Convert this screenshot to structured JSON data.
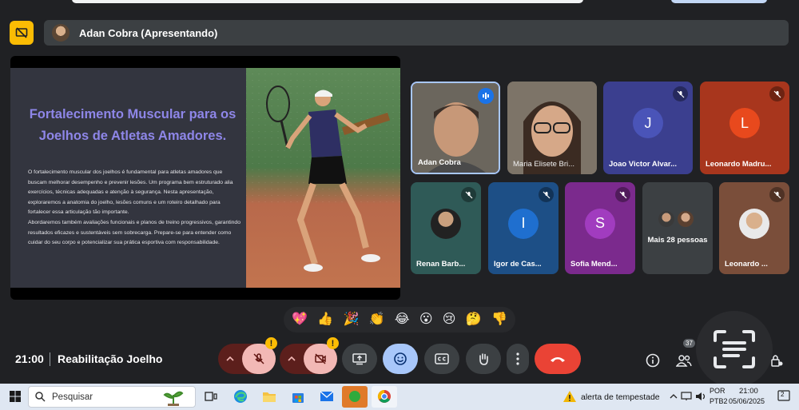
{
  "presenter_bar": {
    "name": "Adan Cobra (Apresentando)"
  },
  "slide": {
    "title": "Fortalecimento Muscular para os Joelhos de Atletas Amadores.",
    "paragraph1": "O fortalecimento muscular dos joelhos é fundamental para atletas amadores que buscam melhorar desempenho e prevenir lesões. Um programa bem estruturado alia exercícios, técnicas adequadas e atenção à segurança. Nesta apresentação, exploraremos a anatomia do joelho, lesões comuns e um roteiro detalhado para fortalecer essa articulação tão importante.",
    "paragraph2": "Abordaremos também avaliações funcionais e planos de treino progressivos, garantindo resultados eficazes e sustentáveis sem sobrecarga. Prepare-se para entender como cuidar do seu corpo e potencializar sua prática esportiva com responsabilidade."
  },
  "participants": [
    {
      "name": "Adan Cobra",
      "type": "video",
      "speaking": true
    },
    {
      "name": "Maria Elisete Bri...",
      "type": "video"
    },
    {
      "name": "Joao Victor Alvar...",
      "letter": "J",
      "bg": "#3b3f8f",
      "avatar_bg": "#4a54b8",
      "muted": true
    },
    {
      "name": "Leonardo Madru...",
      "letter": "L",
      "bg": "#a8361d",
      "avatar_bg": "#e8491d",
      "muted": true
    },
    {
      "name": "Renan Barb...",
      "type": "photo",
      "bg": "#2f5a57",
      "muted": true
    },
    {
      "name": "Igor de Cas...",
      "letter": "I",
      "bg": "#1d4f86",
      "avatar_bg": "#1f6fcf",
      "muted": true
    },
    {
      "name": "Sofia Mend...",
      "letter": "S",
      "bg": "#7b2a8d",
      "avatar_bg": "#a13cbf",
      "muted": true
    },
    {
      "name": "Mais 28 pessoas",
      "type": "more",
      "bg": "#3c4043"
    },
    {
      "name": "Leonardo ...",
      "type": "photo",
      "bg": "#7a4e3a",
      "muted": true
    }
  ],
  "reactions": [
    "💖",
    "👍",
    "🎉",
    "👏",
    "😂",
    "😮",
    "😢",
    "🤔",
    "👎"
  ],
  "bottom": {
    "time": "21:00",
    "meeting_title": "Reabilitação Joelho",
    "participant_count": "37"
  },
  "taskbar": {
    "search_placeholder": "Pesquisar",
    "weather_alert": "alerta de tempestade",
    "lang_line1": "POR",
    "lang_line2": "PTB2",
    "clock_time": "21:00",
    "clock_date": "05/06/2025",
    "notification_count": "2"
  },
  "colors": {
    "meet_bg": "#202124",
    "present_accent": "#fbbc04",
    "end_call": "#ea4335",
    "mic_off_bg": "#f2b8b5",
    "reaction_active": "#a8c7fa",
    "slide_title": "#8e86e8"
  }
}
